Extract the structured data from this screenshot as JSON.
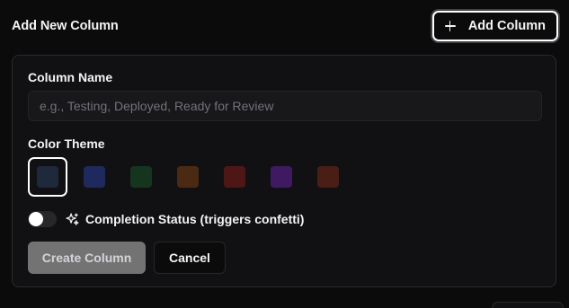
{
  "header": {
    "title": "Add New Column",
    "add_button_label": "Add Column"
  },
  "form": {
    "column_name_label": "Column Name",
    "column_name_placeholder": "e.g., Testing, Deployed, Ready for Review",
    "column_name_value": "",
    "color_theme_label": "Color Theme",
    "color_options": [
      {
        "name": "slate",
        "color": "#1e293b",
        "selected": true
      },
      {
        "name": "blue",
        "color": "#1e2a5e",
        "selected": false
      },
      {
        "name": "green",
        "color": "#15351f",
        "selected": false
      },
      {
        "name": "orange",
        "color": "#4a2a12",
        "selected": false
      },
      {
        "name": "red",
        "color": "#4f1616",
        "selected": false
      },
      {
        "name": "purple",
        "color": "#3f1a63",
        "selected": false
      },
      {
        "name": "brown-red",
        "color": "#4a1e14",
        "selected": false
      }
    ],
    "completion_status_label": "Completion Status (triggers confetti)",
    "completion_status_on": false,
    "create_button_label": "Create Column",
    "cancel_button_label": "Cancel"
  },
  "colors": {
    "background": "#0b0b0c",
    "card": "#111113",
    "create_button_disabled": "#737373"
  }
}
